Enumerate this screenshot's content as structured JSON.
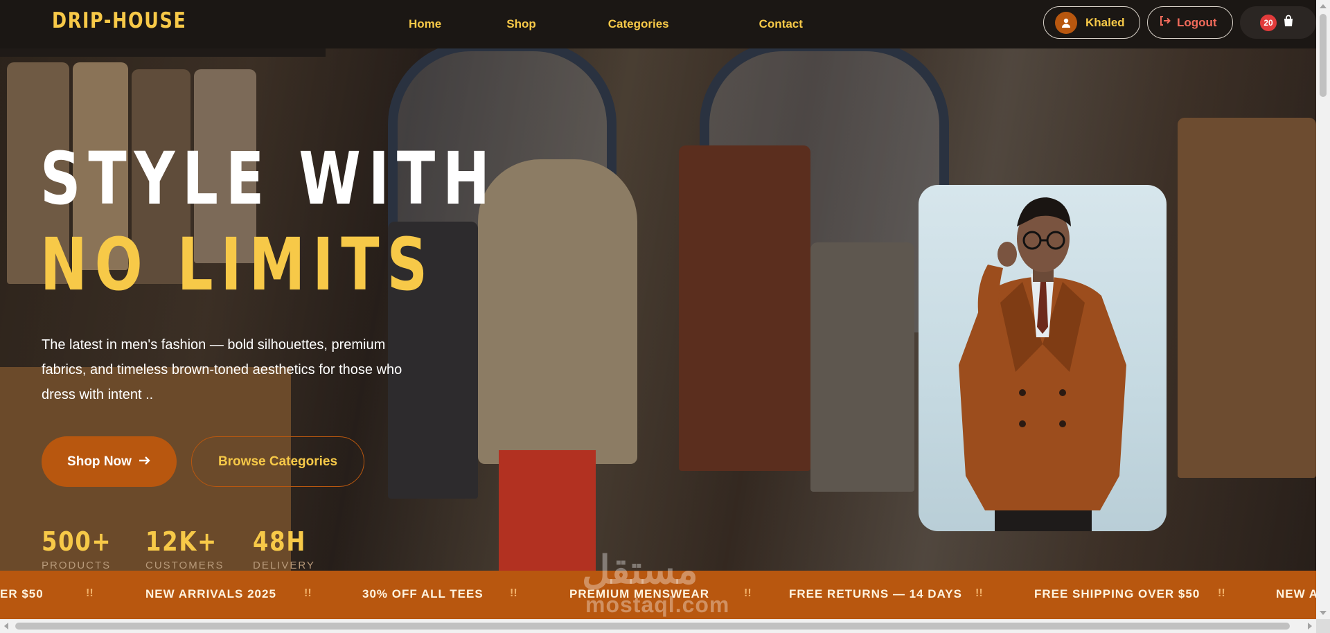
{
  "brand": {
    "logo": "DRIP-HOUSE"
  },
  "nav": {
    "links": [
      {
        "label": "Home"
      },
      {
        "label": "Shop"
      },
      {
        "label": "Categories"
      },
      {
        "label": "Contact"
      }
    ]
  },
  "header": {
    "user_name": "Khaled",
    "logout_label": "Logout",
    "cart_count": "20",
    "icons": [
      "user-icon",
      "logout-icon",
      "shopping-bag-icon"
    ]
  },
  "hero": {
    "title_line1": "STYLE WITH",
    "title_line2": "NO LIMITS",
    "description": "The latest in men's fashion — bold silhouettes, premium fabrics, and timeless brown-toned aesthetics for those who dress with intent ..",
    "primary_button": "Shop Now",
    "secondary_button": "Browse Categories",
    "stats": [
      {
        "value": "500+",
        "label": "PRODUCTS"
      },
      {
        "value": "12K+",
        "label": "CUSTOMERS"
      },
      {
        "value": "48H",
        "label": "DELIVERY"
      }
    ]
  },
  "ticker": {
    "separator": "!!",
    "items": [
      "ER $50",
      "NEW ARRIVALS 2025",
      "30% OFF ALL TEES",
      "PREMIUM MENSWEAR",
      "FREE RETURNS — 14 DAYS",
      "FREE SHIPPING OVER $50",
      "NEW AR"
    ]
  },
  "watermark": {
    "arabic": "مستقل",
    "latin": "mostaql.com"
  },
  "colors": {
    "accent_yellow": "#f7c948",
    "accent_brown": "#b8570f",
    "navbar_bg": "#1b1714",
    "logout_red": "#f26b5b",
    "badge_red": "#e23b3b"
  }
}
